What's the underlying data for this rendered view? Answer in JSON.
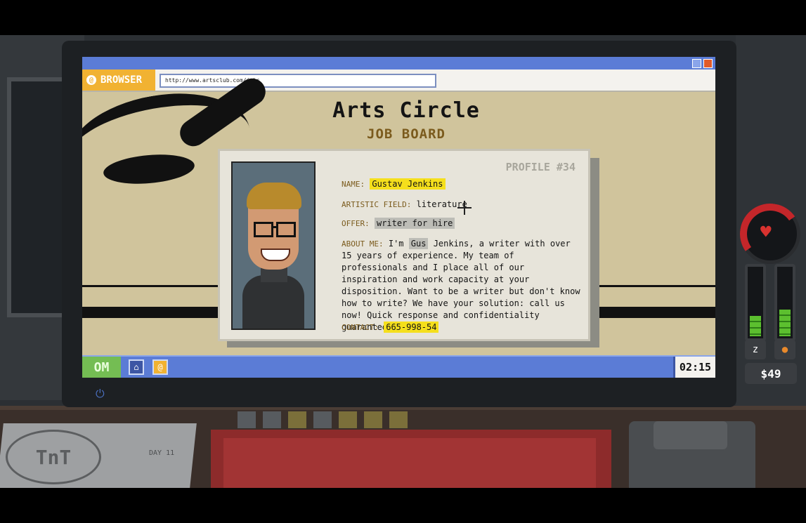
{
  "browser": {
    "label": "BROWSER",
    "url": "http://www.artsclub.com/jobs",
    "icon": "at-sign-icon"
  },
  "site": {
    "title": "Arts Circle",
    "subtitle": "JOB BOARD"
  },
  "profile": {
    "id": "PROFILE #34",
    "name_label": "NAME:",
    "name": "Gustav Jenkins",
    "field_label": "ARTISTIC FIELD:",
    "field": "literature",
    "offer_label": "OFFER:",
    "offer": "writer for hire",
    "about_label": "ABOUT ME:",
    "about_pre": "I'm",
    "about_highlight": "Gus",
    "about_post": "Jenkins, a writer with over 15 years of experience. My team of professionals and I place all of our inspiration and work capacity at your disposition. Want to be a writer but don't know how to write? We have your solution: call us now! Quick response and confidentiality guaranteed.",
    "contact_label": "CONTACT:",
    "contact": "665-998-54"
  },
  "taskbar": {
    "start_label": "OM",
    "clock": "02:15",
    "icons": [
      "home-icon",
      "browser-icon"
    ]
  },
  "hud": {
    "money": "$49",
    "sleep_level": 0.3,
    "food_level": 0.4,
    "health_level": 0.25
  },
  "desk": {
    "notebook_logo": "TnT",
    "notebook_day": "DAY 11"
  },
  "colors": {
    "accent_blue": "#5b7cd6",
    "browser_orange": "#f1b232",
    "highlight_yellow": "#f5df1c",
    "label_brown": "#7b5b1d",
    "page_bg": "#d0c49c"
  }
}
